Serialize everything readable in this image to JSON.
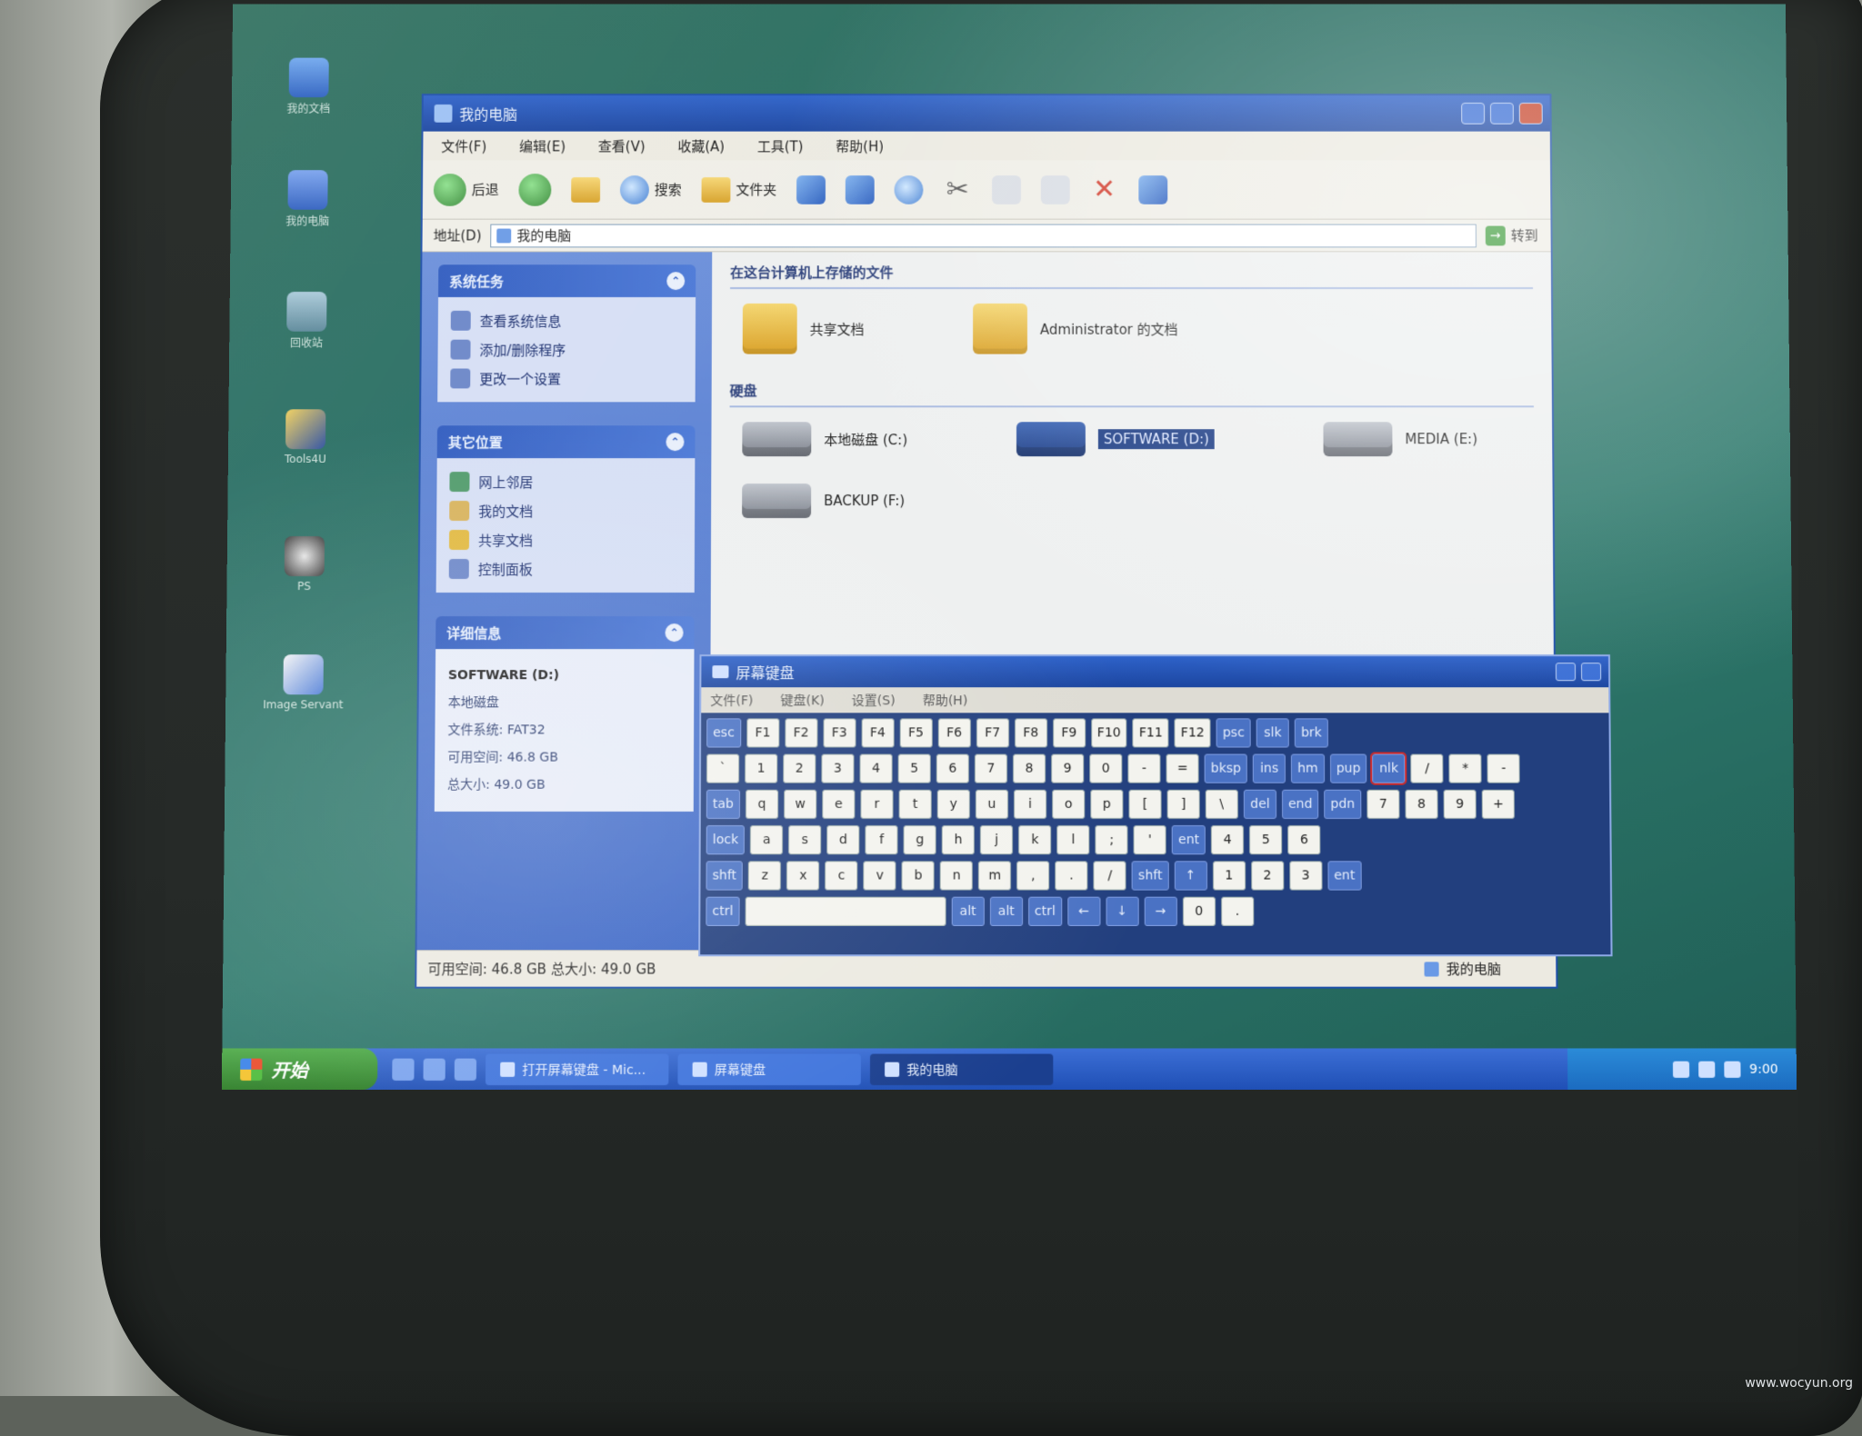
{
  "explorer": {
    "title": "我的电脑",
    "menu": [
      "文件(F)",
      "编辑(E)",
      "查看(V)",
      "收藏(A)",
      "工具(T)",
      "帮助(H)"
    ],
    "toolbar": {
      "back": "后退",
      "search": "搜索",
      "folders": "文件夹"
    },
    "address": {
      "label": "地址(D)",
      "value": "我的电脑",
      "go": "转到"
    },
    "tasks": {
      "system_title": "系统任务",
      "system_items": [
        "查看系统信息",
        "添加/删除程序",
        "更改一个设置"
      ],
      "other_title": "其它位置",
      "other_items": [
        "网上邻居",
        "我的文档",
        "共享文档",
        "控制面板"
      ],
      "details_title": "详细信息",
      "details": {
        "name": "SOFTWARE (D:)",
        "type": "本地磁盘",
        "fs": "文件系统: FAT32",
        "free": "可用空间: 46.8 GB",
        "total": "总大小: 49.0 GB"
      }
    },
    "content": {
      "files_title": "在这台计算机上存储的文件",
      "shared_docs": "共享文档",
      "admin_docs": "Administrator 的文档",
      "drives_title": "硬盘",
      "drives": [
        "本地磁盘 (C:)",
        "SOFTWARE (D:)",
        "MEDIA (E:)",
        "BACKUP (F:)"
      ]
    },
    "status": {
      "free": "可用空间: 46.8 GB 总大小: 49.0 GB",
      "location": "我的电脑"
    }
  },
  "osk": {
    "title": "屏幕键盘",
    "menu": [
      "文件(F)",
      "键盘(K)",
      "设置(S)",
      "帮助(H)"
    ],
    "rows": [
      [
        "esc",
        "F1",
        "F2",
        "F3",
        "F4",
        "F5",
        "F6",
        "F7",
        "F8",
        "F9",
        "F10",
        "F11",
        "F12",
        "psc",
        "slk",
        "brk"
      ],
      [
        "`",
        "1",
        "2",
        "3",
        "4",
        "5",
        "6",
        "7",
        "8",
        "9",
        "0",
        "-",
        "=",
        "bksp",
        "ins",
        "hm",
        "pup",
        "nlk",
        "/",
        "*",
        "-"
      ],
      [
        "tab",
        "q",
        "w",
        "e",
        "r",
        "t",
        "y",
        "u",
        "i",
        "o",
        "p",
        "[",
        "]",
        "\\",
        "del",
        "end",
        "pdn",
        "7",
        "8",
        "9",
        "+"
      ],
      [
        "lock",
        "a",
        "s",
        "d",
        "f",
        "g",
        "h",
        "j",
        "k",
        "l",
        ";",
        "'",
        "ent",
        "4",
        "5",
        "6"
      ],
      [
        "shft",
        "z",
        "x",
        "c",
        "v",
        "b",
        "n",
        "m",
        ",",
        ".",
        "/",
        "shft",
        "↑",
        "1",
        "2",
        "3",
        "ent"
      ],
      [
        "ctrl",
        "alt",
        "alt",
        "ctrl",
        "←",
        "↓",
        "→",
        "0",
        "."
      ]
    ]
  },
  "taskbar": {
    "start": "开始",
    "buttons": [
      "打开屏幕键盘 - Mic...",
      "屏幕键盘",
      "我的电脑"
    ],
    "clock": "9:00"
  },
  "desktop": {
    "icons": [
      "我的文档",
      "我的电脑",
      "回收站",
      "Tools4U",
      "PS",
      "Image Servant"
    ]
  },
  "watermark": "www.wocyun.org"
}
